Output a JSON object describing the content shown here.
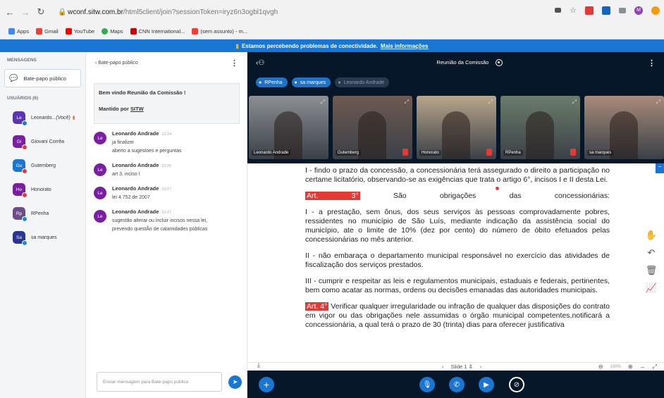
{
  "browser": {
    "url_domain": "wconf.sitw.com.br",
    "url_path": "/html5client/join?sessionToken=iryz6n3ogbl1qvgh",
    "bookmarks": [
      "Apps",
      "Gmail",
      "YouTube",
      "Maps",
      "CNN International...",
      "(sem assunto) - m..."
    ],
    "profile_initial": "M"
  },
  "notice": {
    "text": "Estamos percebendo problemas de conectividade.",
    "link": "Mais informações"
  },
  "users_panel": {
    "messages_heading": "MENSAGENS",
    "public_chat": "Bate-papo público",
    "users_heading": "USUÁRIOS (6)",
    "users": [
      {
        "initials": "Le",
        "name": "Leonardo...",
        "suffix": "(Você)",
        "color": "#5e35b1",
        "dot": "#1976d2"
      },
      {
        "initials": "Gi",
        "name": "Giovani Corrêa",
        "suffix": "",
        "color": "#7b1fa2",
        "dot": "#e53935"
      },
      {
        "initials": "Gu",
        "name": "Gutemberg",
        "suffix": "",
        "color": "#1976d2",
        "dot": "#e53935"
      },
      {
        "initials": "Ho",
        "name": "Honorato",
        "suffix": "",
        "color": "#7b1fa2",
        "dot": "#e53935"
      },
      {
        "initials": "Rp",
        "name": "RPenha",
        "suffix": "",
        "color": "#6d4c8a",
        "dot": "#1e88e5"
      },
      {
        "initials": "Sa",
        "name": "sa marques",
        "suffix": "",
        "color": "#283593",
        "dot": "#1e88e5"
      }
    ]
  },
  "chat": {
    "header": "Bate-papo público",
    "welcome_prefix": "Bem vindo ",
    "welcome_room": "Reunião da Comissão !",
    "kept_by_prefix": "Mantido por ",
    "kept_by": "SITW",
    "messages": [
      {
        "name": "Leonardo Andrade",
        "time": "10:24",
        "lines": [
          "ja finalizei",
          "aberto a sugestoes e perguntas"
        ]
      },
      {
        "name": "Leonardo Andrade",
        "time": "10:25",
        "lines": [
          "art 3, inciso I"
        ]
      },
      {
        "name": "Leonardo Andrade",
        "time": "10:27",
        "lines": [
          "lei 4.752 de 2007"
        ]
      },
      {
        "name": "Leonardo Andrade",
        "time": "10:27",
        "lines": [
          "sugestão alterar ou incluir incisos nessa lei,",
          "prevendo questÃo de calamidades públicas"
        ]
      }
    ],
    "input_placeholder": "Enviar mensagem para Bate-papo público"
  },
  "meeting": {
    "title": "Reunião da Comissão",
    "talkers": [
      {
        "name": "RPenha",
        "active": true
      },
      {
        "name": "sa marques",
        "active": true
      },
      {
        "name": "Leonardo Andrade",
        "active": false
      }
    ],
    "videos": [
      {
        "label": "Leonardo Andrade",
        "bg": "#8c8f93",
        "muted": false
      },
      {
        "label": "Gutemberg",
        "bg": "#6e5a52",
        "muted": true
      },
      {
        "label": "Honorato",
        "bg": "#b9a58b",
        "muted": true
      },
      {
        "label": "RPenha",
        "bg": "#6b7c6b",
        "muted": true
      },
      {
        "label": "sa marques",
        "bg": "#a98b7a",
        "muted": false
      }
    ]
  },
  "slide": {
    "p1": "I - findo o prazo da concessão, a concessionária terá assegurado o direito a participação no certame licitatório, observando-se as exigências que trata o artigo 6°, incisos I e II desta Lei.",
    "art3_label": "Art. 3°",
    "art3_text": " São obrigações das concessionárias:",
    "p2": "I - a prestação, sem ônus, dos seus serviços às pessoas comprovadamente pobres, ressidentes no município de São Luís, mediante indicação da assistência social do município, ate o limite de 10% (dez por cento) do número de óbito efetuados pelas concessionárias no mês anterior.",
    "p3": "II - não embaraça o departamento municipal responsável no exercício das atividades de fiscalização dos serviços prestados.",
    "p4": "III - cumprir e respeitar as leis e regulamentos municipais, estaduais e federais, pertinentes, bem como acatar as normas, ordens ou decisões emanadas das autoridades municipais.",
    "art4_label": "Art. 4°",
    "art4_text": " Verificar qualquer irregularidade ou infração de qualquer das disposições do contrato em vigor ou das obrigações nele assumidas o órgão municipal competentes,notificará a concessionária, a qual terá o prazo de 30 (trinta) dias para oferecer justificativa",
    "slide_label": "Slide 1",
    "zoom": "100%"
  }
}
